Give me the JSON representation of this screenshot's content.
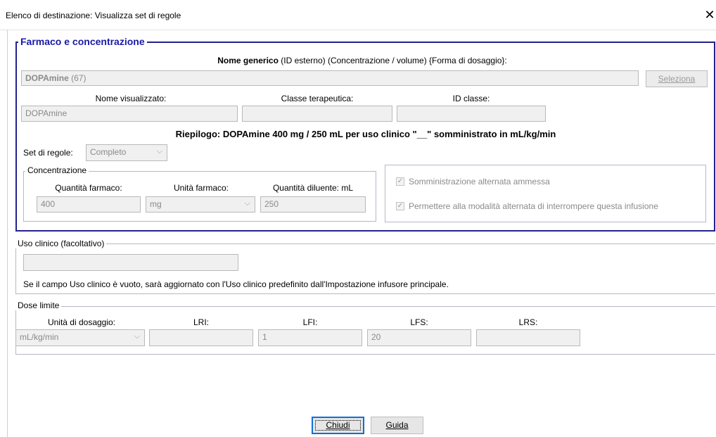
{
  "window": {
    "title": "Elenco di destinazione: Visualizza set di regole",
    "close": "✕"
  },
  "drug": {
    "legend": "Farmaco e concentrazione",
    "generic_header_bold": "Nome generico",
    "generic_header_rest": " (ID esterno) (Concentrazione / volume) {Forma di dosaggio}:",
    "generic_value_bold": "DOPAmine",
    "generic_value_rest": " (67)",
    "select_button": "Seleziona",
    "display_name_label": "Nome visualizzato:",
    "display_name_value": "DOPAmine",
    "therapeutic_class_label": "Classe terapeutica:",
    "therapeutic_class_value": "",
    "class_id_label": "ID classe:",
    "class_id_value": "",
    "summary": "Riepilogo: DOPAmine 400 mg / 250 mL per uso clinico \"__\" somministrato in mL/kg/min",
    "rule_set_label": "Set di regole:",
    "rule_set_value": "Completo"
  },
  "concentration": {
    "legend": "Concentrazione",
    "drug_amount_label": "Quantità farmaco:",
    "drug_amount_value": "400",
    "drug_unit_label": "Unità farmaco:",
    "drug_unit_value": "mg",
    "diluent_label": "Quantità diluente: mL",
    "diluent_value": "250"
  },
  "options": {
    "alt_admin_allowed": "Somministrazione alternata ammessa",
    "alt_mode_interrupt": "Permettere alla modalità alternata di interrompere questa infusione",
    "check_glyph": "✓"
  },
  "clinical_use": {
    "legend": "Uso clinico (facoltativo)",
    "value": "",
    "note": "Se il campo Uso clinico è vuoto, sarà aggiornato con l'Uso clinico predefinito dall'Impostazione infusore principale."
  },
  "dose_limits": {
    "legend": "Dose limite",
    "unit_label": "Unità di dosaggio:",
    "unit_value": "mL/kg/min",
    "lri_label": "LRI:",
    "lri_value": "",
    "lfi_label": "LFI:",
    "lfi_value": "1",
    "lfs_label": "LFS:",
    "lfs_value": "20",
    "lrs_label": "LRS:",
    "lrs_value": ""
  },
  "buttons": {
    "close": "Chiudi",
    "help": "Guida"
  },
  "icons": {
    "chevron": "⌵"
  }
}
